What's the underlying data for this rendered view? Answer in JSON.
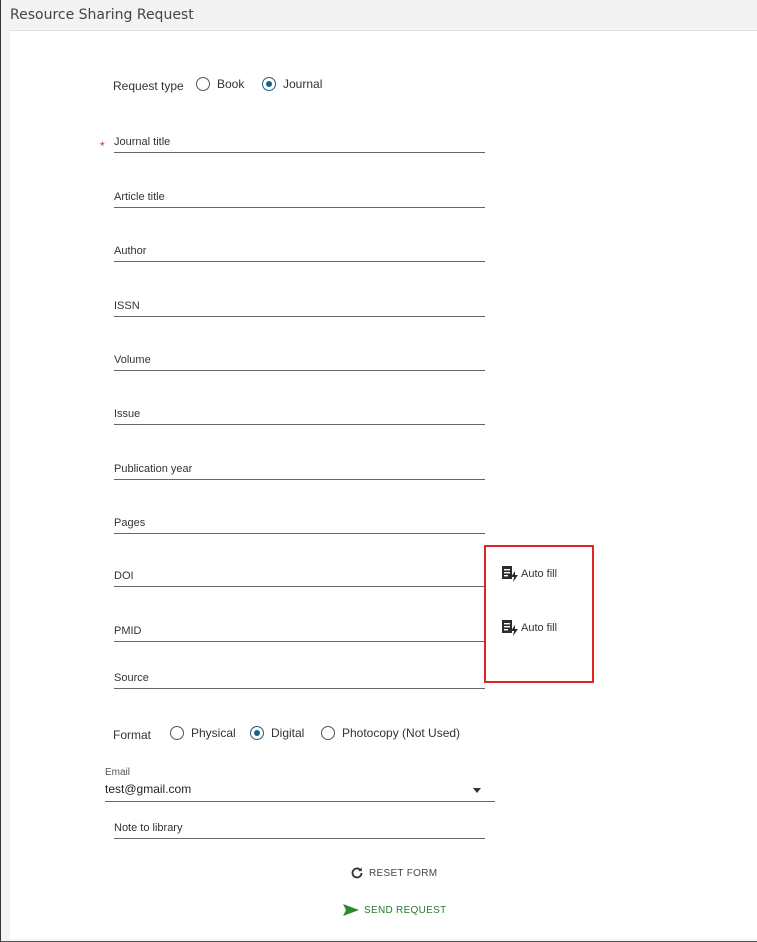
{
  "header": {
    "title": "Resource Sharing Request"
  },
  "request_type": {
    "label": "Request type",
    "options": [
      {
        "label": "Book",
        "checked": false
      },
      {
        "label": "Journal",
        "checked": true
      }
    ]
  },
  "fields": {
    "journal_title": {
      "label": "Journal title",
      "required_mark": "*"
    },
    "article_title": {
      "label": "Article title"
    },
    "author": {
      "label": "Author"
    },
    "issn": {
      "label": "ISSN"
    },
    "volume": {
      "label": "Volume"
    },
    "issue": {
      "label": "Issue"
    },
    "publication_year": {
      "label": "Publication year"
    },
    "pages": {
      "label": "Pages"
    },
    "doi": {
      "label": "DOI"
    },
    "pmid": {
      "label": "PMID"
    },
    "source": {
      "label": "Source"
    },
    "note": {
      "label": "Note to library"
    }
  },
  "autofill": {
    "doi_label": "Auto fill",
    "pmid_label": "Auto fill",
    "icon": "autofill-icon"
  },
  "format": {
    "label": "Format",
    "options": [
      {
        "label": "Physical",
        "checked": false
      },
      {
        "label": "Digital",
        "checked": true
      },
      {
        "label": "Photocopy (Not Used)",
        "checked": false
      }
    ]
  },
  "email": {
    "label": "Email",
    "value": "test@gmail.com"
  },
  "actions": {
    "reset_label": "RESET FORM",
    "send_label": "SEND REQUEST"
  },
  "colors": {
    "accent": "#1f5f82",
    "required": "#d0352b",
    "highlight": "#e02323",
    "send": "#2a7a2a"
  }
}
